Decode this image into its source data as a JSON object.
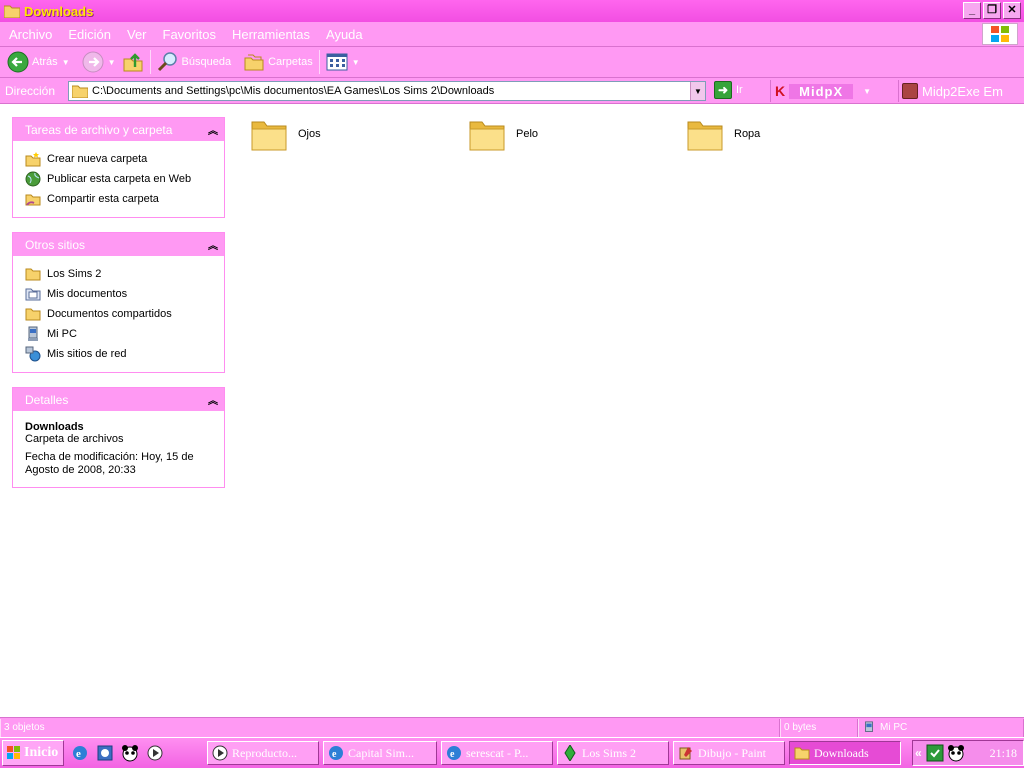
{
  "window": {
    "title": "Downloads"
  },
  "menu": [
    "Archivo",
    "Edición",
    "Ver",
    "Favoritos",
    "Herramientas",
    "Ayuda"
  ],
  "toolbar": {
    "back_label": "Atrás",
    "search_label": "Búsqueda",
    "folders_label": "Carpetas"
  },
  "address": {
    "label": "Dirección",
    "value": "C:\\Documents and Settings\\pc\\Mis documentos\\EA Games\\Los Sims 2\\Downloads",
    "go_label": "Ir",
    "midpx_label": "MidpX",
    "midp2exe_label": "Midp2Exe Em"
  },
  "tasks_panel": {
    "title": "Tareas de archivo y carpeta",
    "items": [
      "Crear nueva carpeta",
      "Publicar esta carpeta en Web",
      "Compartir esta carpeta"
    ]
  },
  "other_places": {
    "title": "Otros sitios",
    "items": [
      "Los Sims 2",
      "Mis documentos",
      "Documentos compartidos",
      "Mi PC",
      "Mis sitios de red"
    ]
  },
  "details": {
    "title": "Detalles",
    "name": "Downloads",
    "type": "Carpeta de archivos",
    "modified_1": "Fecha de modificación: Hoy, 15 de",
    "modified_2": "Agosto de 2008, 20:33"
  },
  "folders": [
    "Ojos",
    "Pelo",
    "Ropa"
  ],
  "status": {
    "objects": "3 objetos",
    "size": "0 bytes",
    "location": "Mi PC"
  },
  "taskbar": {
    "start_label": "Inicio",
    "tasks": [
      "Reproducto...",
      "Capital Sim...",
      "serescat - P...",
      "Los Sims 2",
      "Dibujo - Paint",
      "Downloads"
    ],
    "clock": "21:18"
  },
  "colors": {
    "chrome_pink": "#ff99f3",
    "title_pink": "#f24ee2",
    "title_text": "#ffe800"
  }
}
